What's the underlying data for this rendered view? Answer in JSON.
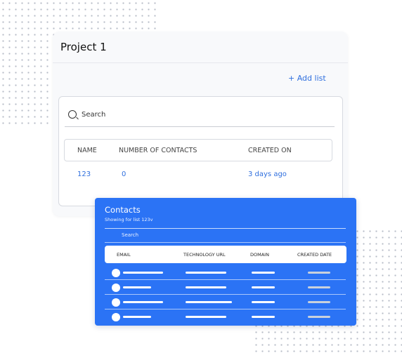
{
  "project": {
    "title": "Project 1",
    "add_list_label": "+ Add list",
    "search_placeholder": "Search",
    "columns": [
      "NAME",
      "NUMBER OF CONTACTS",
      "CREATED ON"
    ],
    "rows": [
      {
        "name": "123",
        "contacts": "0",
        "created": "3 days ago"
      }
    ],
    "accent_color": "#2f6fde"
  },
  "contacts": {
    "title": "Contacts",
    "subtitle": "Showing for list 123v",
    "search_placeholder": "Search",
    "columns": [
      "EMAIL",
      "TECHNOLOGY URL",
      "DOMAIN",
      "CREATED DATE"
    ],
    "panel_color": "#2b73f5"
  }
}
